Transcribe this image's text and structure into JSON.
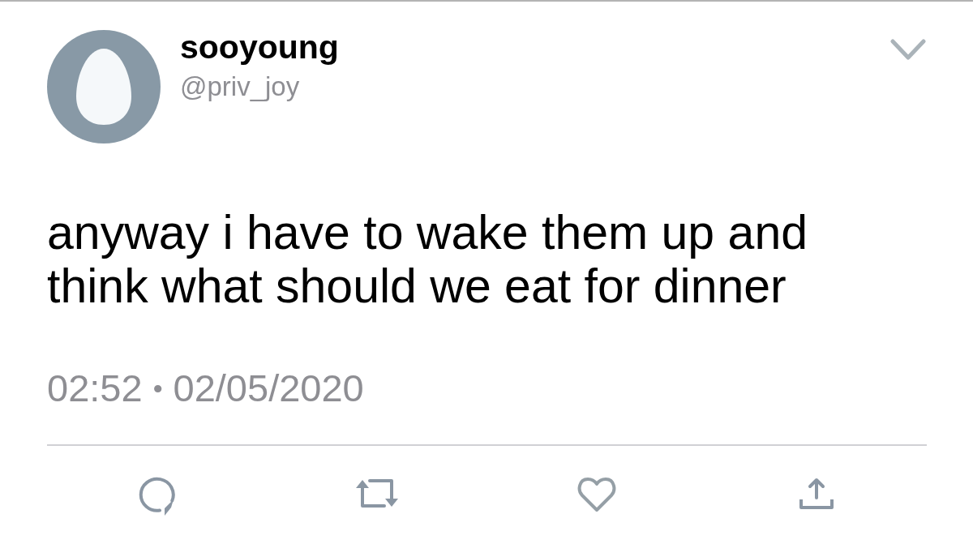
{
  "tweet": {
    "author": {
      "display_name": "sooyoung",
      "handle": "@priv_joy"
    },
    "text": "anyway i have to wake them up and think what should we eat for dinner",
    "time": "02:52",
    "separator": "•",
    "date": "02/05/2020"
  },
  "actions": [
    {
      "kind": "reply"
    },
    {
      "kind": "retweet"
    },
    {
      "kind": "like"
    },
    {
      "kind": "share"
    }
  ]
}
